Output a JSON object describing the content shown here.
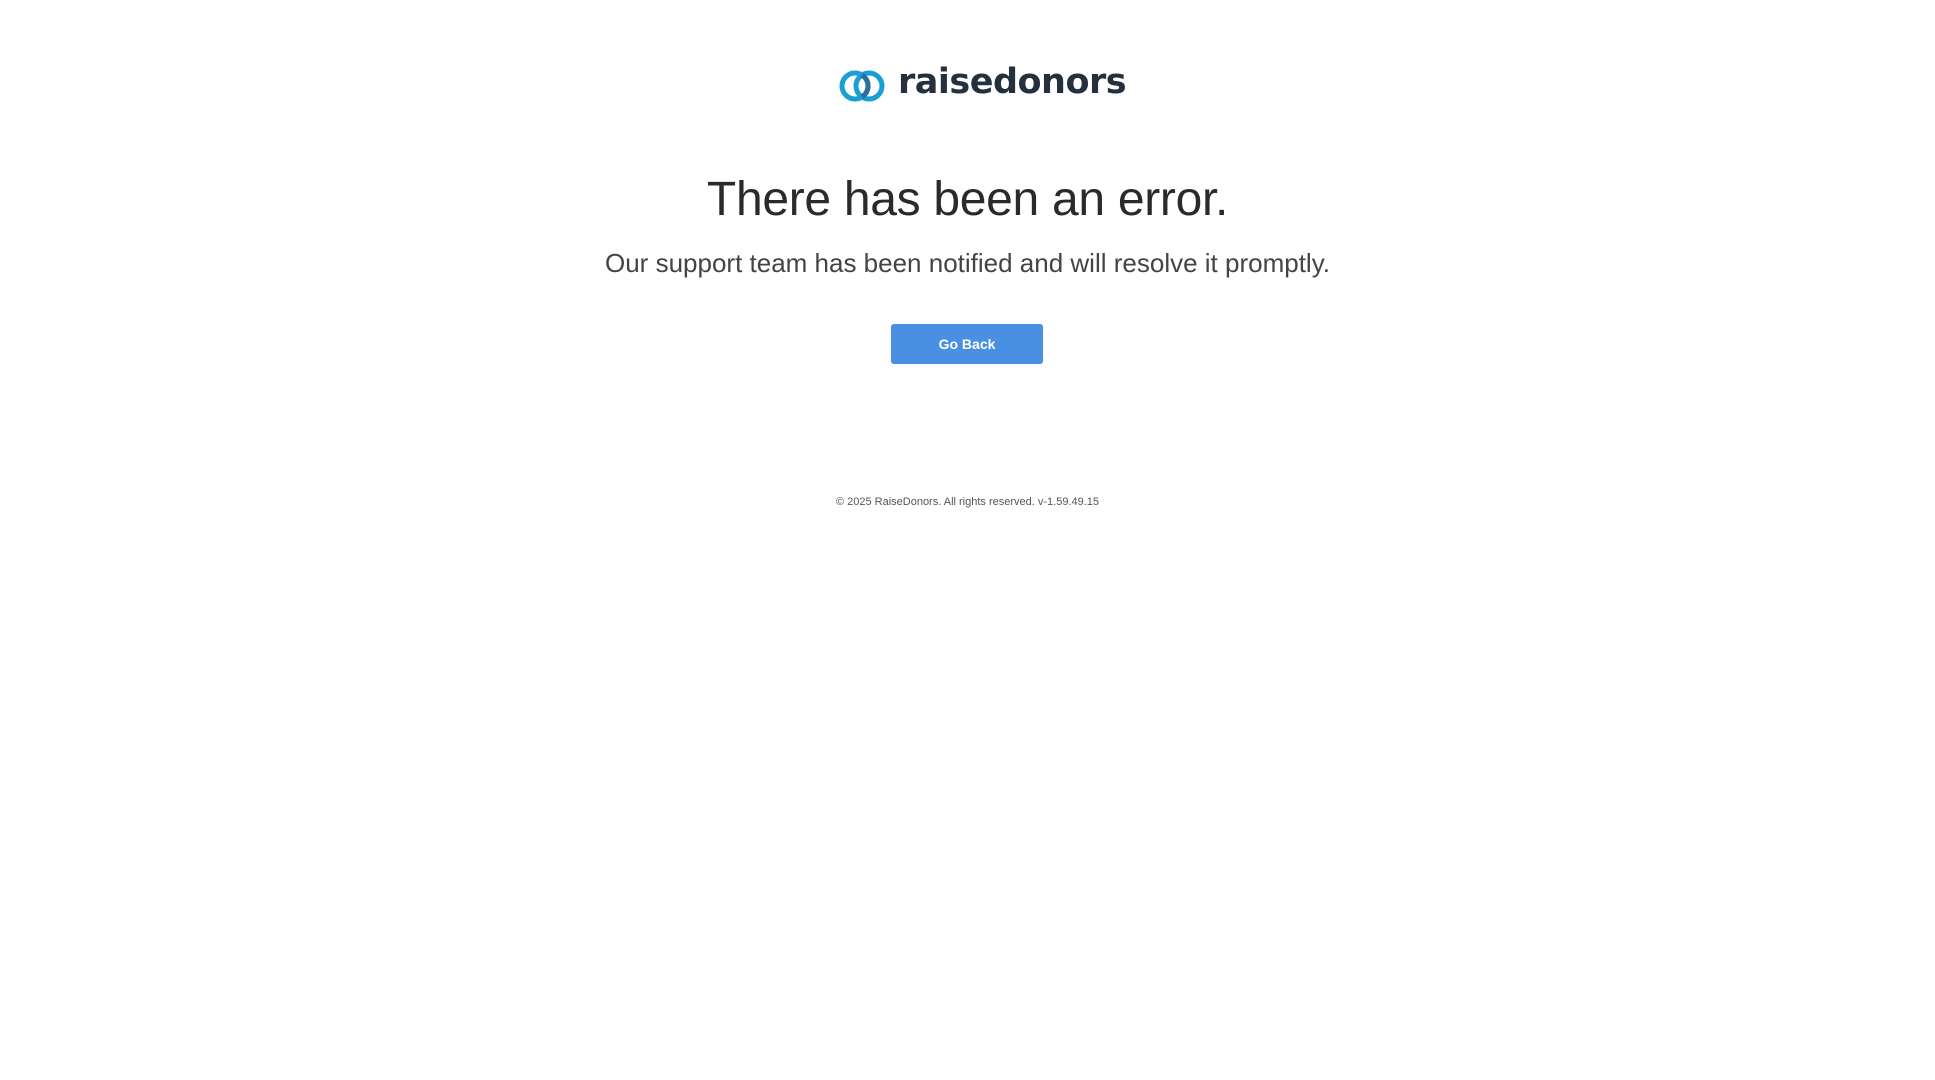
{
  "brand": {
    "name": "raisedonors",
    "logo_icon": "linked-rings-icon",
    "colors": {
      "ring_primary": "#1a9fd4",
      "ring_secondary": "#2c6f9e",
      "wordmark": "#23313f"
    }
  },
  "error": {
    "title": "There has been an error.",
    "message": "Our support team has been notified and will resolve it promptly."
  },
  "actions": {
    "go_back_label": "Go Back",
    "button_color": "#4a90e2"
  },
  "footer": {
    "text": "© 2025 RaiseDonors. All rights reserved. v-1.59.49.15"
  }
}
